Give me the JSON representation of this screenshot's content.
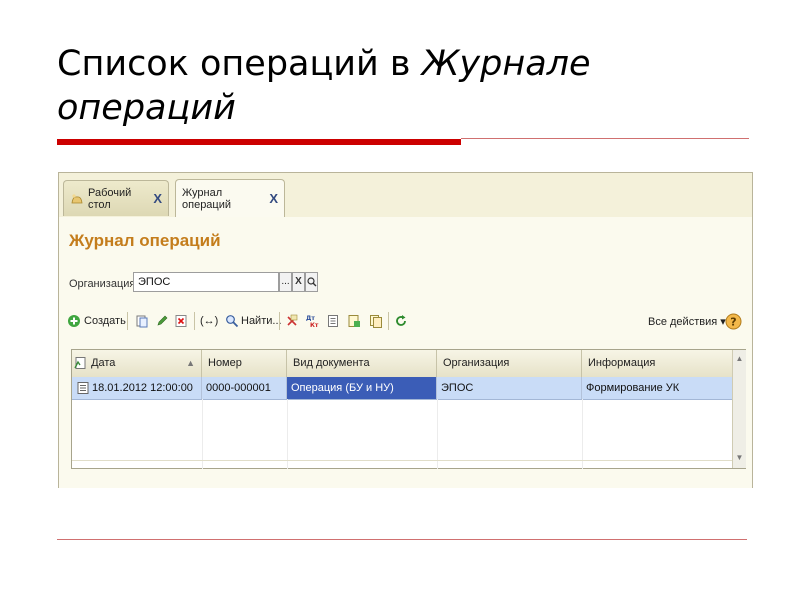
{
  "slide": {
    "title_regular": "Список операций в ",
    "title_italic": "Журнале операций"
  },
  "tabs": [
    {
      "label": "Рабочий стол",
      "close": "X"
    },
    {
      "label": "Журнал операций",
      "close": "X"
    }
  ],
  "form": {
    "title": "Журнал операций",
    "org_label": "Организация:",
    "org_value": "ЭПОС",
    "org_select": "...",
    "org_clear": "X",
    "org_open": "Q"
  },
  "toolbar": {
    "create": "Создать",
    "find": "Найти...",
    "find_prefix": "(↔)",
    "all_actions": "Все действия ▾",
    "help": "?"
  },
  "table": {
    "columns": [
      "Дата",
      "Номер",
      "Вид документа",
      "Организация",
      "Информация"
    ],
    "rows": [
      {
        "date": "18.01.2012 12:00:00",
        "number": "0000-000001",
        "doc_type": "Операция (БУ и НУ)",
        "org": "ЭПОС",
        "info": "Формирование УК"
      }
    ]
  },
  "colors": {
    "title_orange": "#c47d1c",
    "selected_cell": "#3b5db7",
    "row_highlight": "#c9dcf7",
    "accent_red": "#cc0000"
  }
}
